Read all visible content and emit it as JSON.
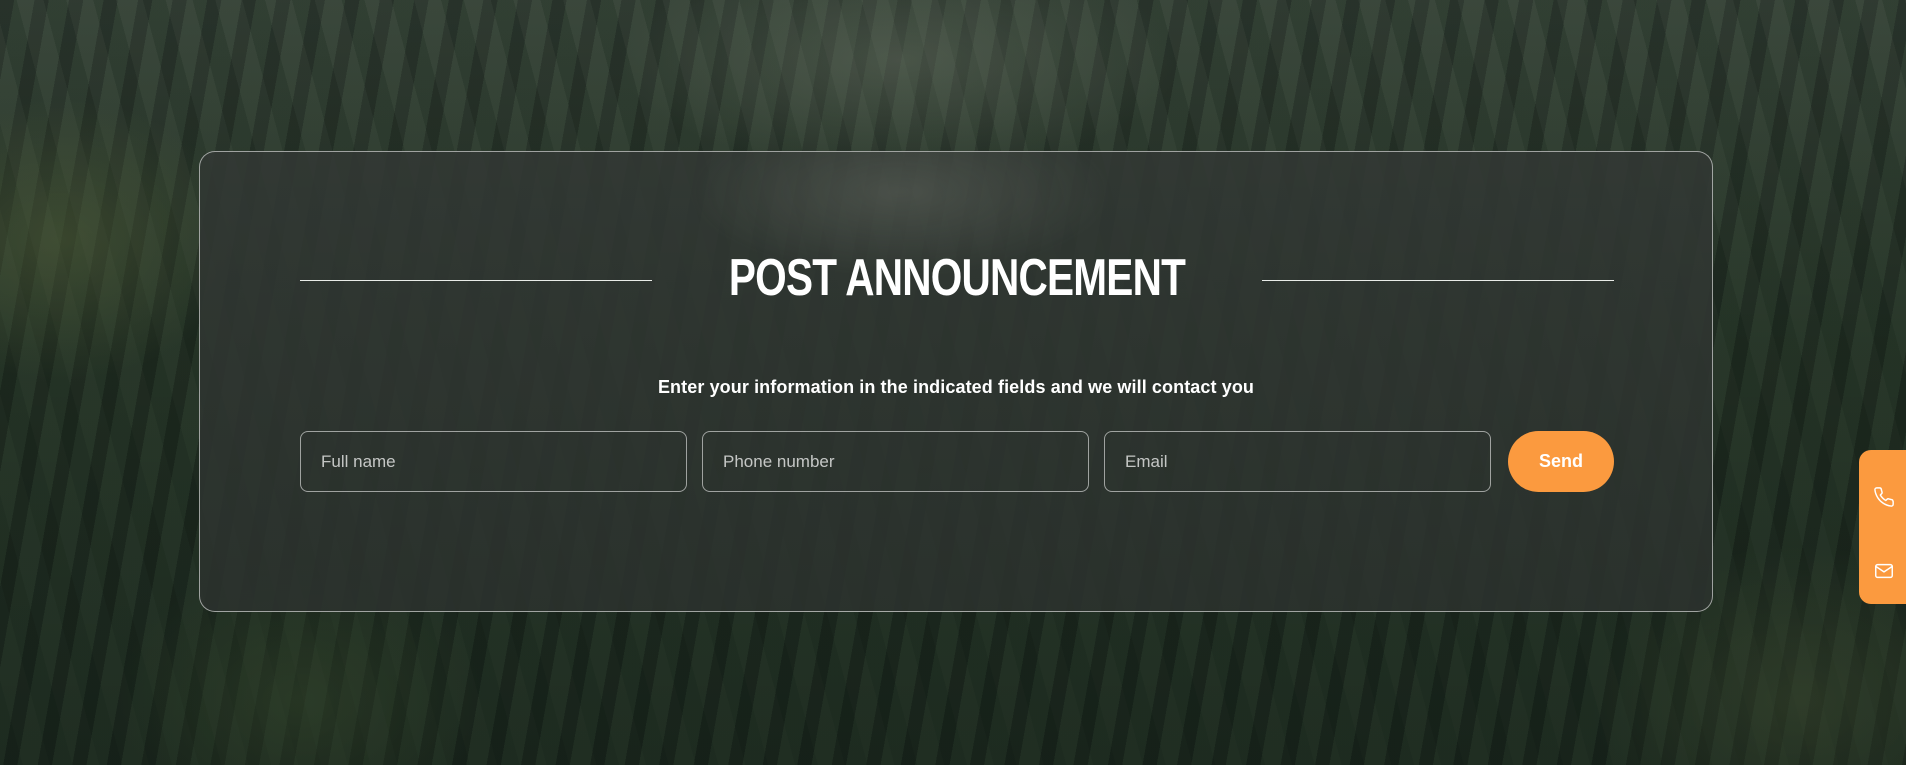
{
  "form": {
    "title": "POST ANNOUNCEMENT",
    "subtitle": "Enter your information in the indicated fields and we will contact you",
    "fields": {
      "name_placeholder": "Full name",
      "phone_placeholder": "Phone number",
      "email_placeholder": "Email"
    },
    "send_label": "Send"
  },
  "side_tab": {
    "icons": [
      "phone-icon",
      "mail-icon"
    ]
  },
  "colors": {
    "accent": "#fb9a3f",
    "text": "#ffffff",
    "card_border": "#c9ccc7"
  }
}
